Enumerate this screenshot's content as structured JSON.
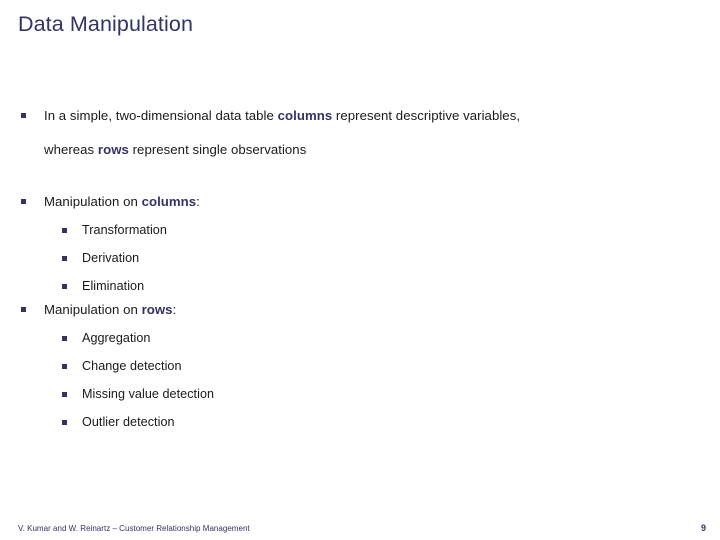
{
  "slide": {
    "title": "Data Manipulation",
    "title_color": "#333366",
    "background_color": "#ffffff",
    "body_text_color": "#1a1a1a",
    "keyword_color": "#333366",
    "bullet_marker_color": "#333366",
    "bullet_glyph": "small-filled-square"
  },
  "body": {
    "intro": {
      "line1_pre": "In a simple, two-dimensional data table ",
      "line1_keyword": "columns",
      "line1_post": " represent descriptive variables,",
      "line2_pre": "whereas ",
      "line2_keyword": "rows",
      "line2_post": " represent single observations"
    },
    "columns_section": {
      "heading_pre": "Manipulation on ",
      "heading_keyword": "columns",
      "heading_post": ":",
      "items": [
        "Transformation",
        "Derivation",
        "Elimination"
      ]
    },
    "rows_section": {
      "heading_pre": "Manipulation on ",
      "heading_keyword": "rows",
      "heading_post": ":",
      "items": [
        "Aggregation",
        "Change detection",
        "Missing value detection",
        "Outlier detection"
      ]
    }
  },
  "footer": {
    "credit": "V. Kumar and W. Reinartz – Customer Relationship Management",
    "page_number": "9"
  }
}
